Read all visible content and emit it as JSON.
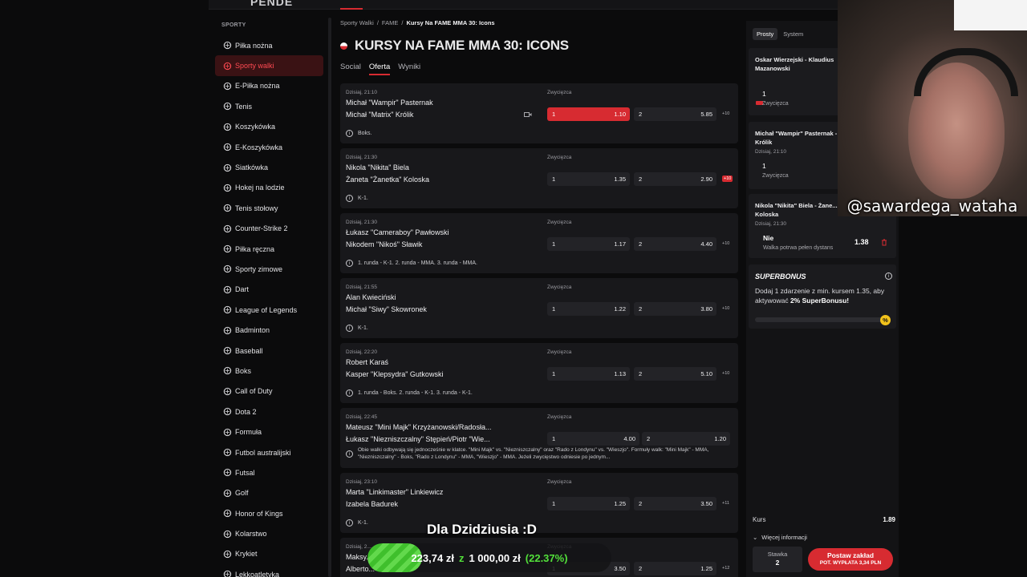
{
  "topbar": {
    "logo_fragment": "PENDE"
  },
  "sidebar": {
    "heading": "SPORTY",
    "items": [
      {
        "label": "Piłka nożna",
        "icon": "soccer-ball-icon"
      },
      {
        "label": "Sporty walki",
        "icon": "ufc-icon",
        "active": true
      },
      {
        "label": "E-Piłka nożna",
        "icon": "fifa-icon"
      },
      {
        "label": "Tenis",
        "icon": "tennis-icon"
      },
      {
        "label": "Koszykówka",
        "icon": "basketball-icon"
      },
      {
        "label": "E-Koszykówka",
        "icon": "e-basketball-icon"
      },
      {
        "label": "Siatkówka",
        "icon": "volleyball-icon"
      },
      {
        "label": "Hokej na lodzie",
        "icon": "hockey-icon"
      },
      {
        "label": "Tenis stołowy",
        "icon": "table-tennis-icon"
      },
      {
        "label": "Counter-Strike 2",
        "icon": "cs2-icon"
      },
      {
        "label": "Piłka ręczna",
        "icon": "handball-icon"
      },
      {
        "label": "Sporty zimowe",
        "icon": "winter-sports-icon"
      },
      {
        "label": "Dart",
        "icon": "dart-icon"
      },
      {
        "label": "League of Legends",
        "icon": "lol-icon"
      },
      {
        "label": "Badminton",
        "icon": "badminton-icon"
      },
      {
        "label": "Baseball",
        "icon": "baseball-icon"
      },
      {
        "label": "Boks",
        "icon": "boxing-icon"
      },
      {
        "label": "Call of Duty",
        "icon": "cod-icon"
      },
      {
        "label": "Dota 2",
        "icon": "dota-icon"
      },
      {
        "label": "Formuła",
        "icon": "formula-icon"
      },
      {
        "label": "Futbol australijski",
        "icon": "aussie-football-icon"
      },
      {
        "label": "Futsal",
        "icon": "futsal-icon"
      },
      {
        "label": "Golf",
        "icon": "golf-icon"
      },
      {
        "label": "Honor of Kings",
        "icon": "honor-of-kings-icon"
      },
      {
        "label": "Kolarstwo",
        "icon": "cycling-icon"
      },
      {
        "label": "Krykiet",
        "icon": "cricket-icon"
      },
      {
        "label": "Lekkoatletyka",
        "icon": "athletics-icon"
      }
    ]
  },
  "main": {
    "breadcrumbs": [
      "Sporty Walki",
      "/",
      "FAME",
      "/",
      "Kursy Na FAME MMA 30: Icons"
    ],
    "title": "KURSY NA FAME MMA 30: ICONS",
    "tabs": [
      {
        "label": "Social"
      },
      {
        "label": "Oferta",
        "active": true
      },
      {
        "label": "Wyniki"
      }
    ],
    "events": [
      {
        "time": "Dzisiaj, 21:10",
        "p1": "Michał \"Wampir\" Pasternak",
        "p2": "Michał \"Matrix\" Królik",
        "market": "Zwycięzca",
        "o1_label": "1",
        "o1": "1.10",
        "o2_label": "2",
        "o2": "5.85",
        "more": "+10",
        "note": "Boks.",
        "selected": true,
        "camera": true
      },
      {
        "time": "Dzisiaj, 21:30",
        "p1": "Nikola \"Nikita\" Biela",
        "p2": "Żaneta \"Żanetka\" Koloska",
        "market": "Zwycięzca",
        "o1_label": "1",
        "o1": "1.35",
        "o2_label": "2",
        "o2": "2.90",
        "more": "+10",
        "note": "K-1.",
        "hot": true
      },
      {
        "time": "Dzisiaj, 21:30",
        "p1": "Łukasz \"Cameraboy\" Pawłowski",
        "p2": "Nikodem \"Nikoś\" Sławik",
        "market": "Zwycięzca",
        "o1_label": "1",
        "o1": "1.17",
        "o2_label": "2",
        "o2": "4.40",
        "more": "+10",
        "note": "1. runda - K-1. 2. runda - MMA. 3. runda - MMA."
      },
      {
        "time": "Dzisiaj, 21:55",
        "p1": "Alan Kwieciński",
        "p2": "Michał \"Siwy\" Skowronek",
        "market": "Zwycięzca",
        "o1_label": "1",
        "o1": "1.22",
        "o2_label": "2",
        "o2": "3.80",
        "more": "+10",
        "note": "K-1."
      },
      {
        "time": "Dzisiaj, 22:20",
        "p1": "Robert Karaś",
        "p2": "Kasper \"Klepsydra\" Gutkowski",
        "market": "Zwycięzca",
        "o1_label": "1",
        "o1": "1.13",
        "o2_label": "2",
        "o2": "5.10",
        "more": "+10",
        "note": "1. runda - Boks. 2. runda - K-1. 3. runda - K-1."
      },
      {
        "time": "Dzisiaj, 22:45",
        "p1": "Mateusz \"Mini Majk\" Krzyżanowski/Radosła...",
        "p2": "Łukasz \"Niezniszczalny\" Stępień/Piotr \"Wie...",
        "market": "Zwycięzca",
        "o1_label": "1",
        "o1": "4.00",
        "o2_label": "2",
        "o2": "1.20",
        "more": "",
        "note": "Obie walki odbywają się jednocześnie w klatce. \"Mini Majk\" vs. \"Niezniszczalny\" oraz \"Rado z Londynu\" vs. \"Wieszjo\". Formuły walk: \"Mini Majk\" - MMA, \"Niezniszczalny\" - Boks, \"Rado z Londynu\" - MMA, \"Wieszjo\" - MMA. Jeżeli zwycięstwo odniesie po jednym...",
        "long": true
      },
      {
        "time": "Dzisiaj, 23:10",
        "p1": "Marta \"Linkimaster\" Linkiewicz",
        "p2": "Izabela Badurek",
        "market": "Zwycięzca",
        "o1_label": "1",
        "o1": "1.25",
        "o2_label": "2",
        "o2": "3.50",
        "more": "+11",
        "note": "K-1."
      },
      {
        "time": "Dzisiaj, 2...",
        "p1": "Maksy...",
        "p2": "Alberto...",
        "market": "Zwycięzca",
        "o1_label": "1",
        "o1": "3.50",
        "o2_label": "2",
        "o2": "1.25",
        "more": "+12",
        "note": ""
      }
    ]
  },
  "betslip": {
    "tabs": [
      {
        "label": "Prosty",
        "active": true
      },
      {
        "label": "System"
      }
    ],
    "bets": [
      {
        "name": "Oskar Wierzejski - Klaudius Mazanowski",
        "when": "",
        "pick": "1",
        "market": "Zwycięzca",
        "odd": "",
        "video": true
      },
      {
        "name": "Michał \"Wampir\" Pasternak - Królik",
        "when": "Dzisiaj, 21:10",
        "pick": "1",
        "market": "Zwycięzca",
        "odd": ""
      },
      {
        "name": "Nikola \"Nikita\" Biela - Żane... Koloska",
        "when": "Dzisiaj, 21:30",
        "pick": "Nie",
        "market": "Walka potrwa pełen dystans",
        "odd": "1.38"
      }
    ],
    "superbonus": {
      "title": "SUPERBONUS",
      "text_pre": "Dodaj 1 zdarzenie z min. kursem 1.35, aby aktywować ",
      "text_bold": "2% SuperBonusu!",
      "badge": "%",
      "progress": 0
    },
    "kurs_label": "Kurs",
    "kurs_value": "1.89",
    "more_info": "Więcej informacji",
    "stake_label": "Stawka",
    "stake_value": "2",
    "place_label": "Postaw zakład",
    "payout": "POT. WYPŁATA 3,34 PLN"
  },
  "webcam": {
    "handle": "@sawardega_wataha"
  },
  "overlay": {
    "caption": "Dla Dzidziusia :D",
    "goal_current": "223,74 zł",
    "goal_sep": "z",
    "goal_target": "1 000,00 zł",
    "goal_percent_text": "(22.37%)",
    "goal_fraction": 0.2237
  },
  "colors": {
    "accent": "#d72b31",
    "background": "#0b0b0c",
    "card": "#18181b",
    "goal_green": "#52e03a"
  }
}
